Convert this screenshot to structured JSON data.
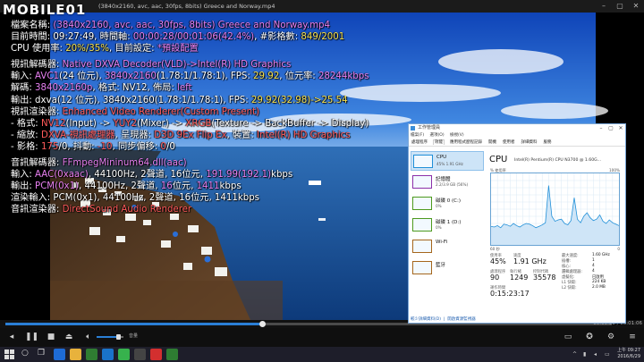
{
  "window": {
    "title": "(3840x2160, avc, aac, 30fps, 8bits) Greece and Norway.mp4",
    "logo": "MOBILE01"
  },
  "osd": {
    "lines": [
      [
        {
          "t": "檔案名稱: ",
          "c": ""
        },
        {
          "t": "(3840x2160, avc, aac, 30fps, 8bits) Greece and Norway.mp4",
          "c": "mg"
        }
      ],
      [
        {
          "t": "目前時間: 09:27:49, 時間軸: ",
          "c": ""
        },
        {
          "t": "00:00:28/00:01:06(42.4%)",
          "c": "mg"
        },
        {
          "t": ", #影格數: ",
          "c": ""
        },
        {
          "t": "849/2001",
          "c": "yl"
        }
      ],
      [
        {
          "t": "CPU 使用率: ",
          "c": ""
        },
        {
          "t": "20%/35%",
          "c": "yl"
        },
        {
          "t": ", 目前設定: ",
          "c": ""
        },
        {
          "t": "*預設配置",
          "c": "mg"
        }
      ],
      "gap",
      [
        {
          "t": "視訊解碼器: ",
          "c": ""
        },
        {
          "t": "Native DXVA Decoder(VLD)->Intel(R) HD Graphics",
          "c": "mg"
        }
      ],
      [
        {
          "t": "輸入: ",
          "c": ""
        },
        {
          "t": "AVC1",
          "c": "mg"
        },
        {
          "t": "(24 位元), ",
          "c": ""
        },
        {
          "t": "3840x2160",
          "c": "mg"
        },
        {
          "t": "(1.78:1/1.78:1), FPS: ",
          "c": ""
        },
        {
          "t": "29.92",
          "c": "yl"
        },
        {
          "t": ", 位元率: ",
          "c": ""
        },
        {
          "t": "28244kbps",
          "c": "mg"
        }
      ],
      [
        {
          "t": "解碼: ",
          "c": ""
        },
        {
          "t": "3840x2160p",
          "c": "mg"
        },
        {
          "t": ", 格式: NV12, 佈局: ",
          "c": ""
        },
        {
          "t": "left",
          "c": "mg"
        }
      ],
      [
        {
          "t": "輸出: dxva(12 位元), 3840x2160(1.78:1/1.78:1), FPS: ",
          "c": ""
        },
        {
          "t": "29.92(32.98)->25.54",
          "c": "yl"
        }
      ],
      [
        {
          "t": "視訊渲染器: ",
          "c": ""
        },
        {
          "t": "Enhanced Video Renderer(Custom Present)",
          "c": "rd"
        }
      ],
      [
        {
          "t": " - 格式: ",
          "c": ""
        },
        {
          "t": "NV12",
          "c": "rd"
        },
        {
          "t": "(Input) -> ",
          "c": ""
        },
        {
          "t": "YUY2",
          "c": "rd"
        },
        {
          "t": "(Mixer) -> ",
          "c": ""
        },
        {
          "t": "XRGB",
          "c": "rd"
        },
        {
          "t": "(Texture -> BackBuffer -> Display)",
          "c": ""
        }
      ],
      [
        {
          "t": " - 縮放: ",
          "c": ""
        },
        {
          "t": "DXVA-視訊處理器",
          "c": "rd"
        },
        {
          "t": ", 呈現器: ",
          "c": ""
        },
        {
          "t": "D3D 9Ex Flip Ex",
          "c": "rd"
        },
        {
          "t": ", 裝置: ",
          "c": ""
        },
        {
          "t": "Intel(R) HD Graphics",
          "c": "rd"
        }
      ],
      [
        {
          "t": " - 影格: ",
          "c": ""
        },
        {
          "t": "175",
          "c": "rd"
        },
        {
          "t": "/0, 抖動: ",
          "c": ""
        },
        {
          "t": "-10",
          "c": "rd"
        },
        {
          "t": ", 同步偏移: ",
          "c": ""
        },
        {
          "t": "0",
          "c": "rd"
        },
        {
          "t": "/0",
          "c": ""
        }
      ],
      "gap",
      [
        {
          "t": "音訊解碼器: ",
          "c": ""
        },
        {
          "t": "FFmpegMininum64.dll(aac)",
          "c": "mg"
        }
      ],
      [
        {
          "t": "輸入: ",
          "c": ""
        },
        {
          "t": "AAC(0xaac)",
          "c": "mg"
        },
        {
          "t": ", 44100Hz, 2聲道, 16位元, ",
          "c": ""
        },
        {
          "t": "191.99(192.1)",
          "c": "mg"
        },
        {
          "t": "kbps",
          "c": ""
        }
      ],
      [
        {
          "t": "輸出: ",
          "c": ""
        },
        {
          "t": "PCM(0x1)",
          "c": "mg"
        },
        {
          "t": ", 44100Hz, 2聲道, ",
          "c": ""
        },
        {
          "t": "16",
          "c": "mg"
        },
        {
          "t": "位元, ",
          "c": ""
        },
        {
          "t": "1411",
          "c": "mg"
        },
        {
          "t": "kbps",
          "c": ""
        }
      ],
      [
        {
          "t": "渲染輸入: PCM(0x1), 44100Hz, 2聲道, 16位元, 1411kbps",
          "c": ""
        }
      ],
      [
        {
          "t": "音訊渲染器: ",
          "c": ""
        },
        {
          "t": "DirectSound Audio Renderer",
          "c": "rd"
        }
      ]
    ]
  },
  "task_manager": {
    "title": "工作管理員",
    "menu": [
      "檔案(F)",
      "選項(O)",
      "檢視(V)"
    ],
    "tabs": [
      "處理程序",
      "效能",
      "應用程式歷程記錄",
      "開機",
      "使用者",
      "詳細資料",
      "服務"
    ],
    "active_tab": 1,
    "side": [
      {
        "name": "CPU",
        "sub": "45% 1.91 GHz",
        "color": "#1f8fd8"
      },
      {
        "name": "記憶體",
        "sub": "2.2/3.9 GB (56%)",
        "color": "#8b2fa8"
      },
      {
        "name": "磁碟 0 (C:)",
        "sub": "0%",
        "color": "#4d9a1e"
      },
      {
        "name": "磁碟 1 (D:)",
        "sub": "0%",
        "color": "#4d9a1e"
      },
      {
        "name": "Wi-Fi",
        "sub": "",
        "color": "#a5661d"
      },
      {
        "name": "藍牙",
        "sub": "",
        "color": "#a5661d"
      }
    ],
    "cpu_title": "CPU",
    "processor": "Intel(R) Pentium(R) CPU N3700 @ 1.60G...",
    "util_label": "% 使用率",
    "util_max": "100%",
    "graph_time": "60 秒",
    "graph_min": "0",
    "graph_values": [
      26,
      25,
      27,
      24,
      29,
      28,
      26,
      30,
      27,
      25,
      28,
      30,
      29,
      27,
      24,
      26,
      28,
      31,
      83,
      40,
      33,
      35,
      36,
      30,
      28,
      34,
      66,
      36,
      31,
      40,
      45,
      38,
      34,
      36,
      42,
      33,
      30,
      35,
      31,
      29,
      27
    ],
    "stats": {
      "util_label": "使用率",
      "util_val": "45%",
      "speed_label": "速度",
      "speed_val": "1.91 GHz",
      "proc_label": "處理程序",
      "proc_val": "90",
      "thr_label": "執行緒",
      "thr_val": "1249",
      "hnd_label": "控制代碼",
      "hnd_val": "35578",
      "up_label": "運作時間",
      "up_val": "0:15:23:17"
    },
    "specs": [
      {
        "k": "最大速度:",
        "v": "1.60 GHz"
      },
      {
        "k": "插槽:",
        "v": "1"
      },
      {
        "k": "核心:",
        "v": "4"
      },
      {
        "k": "邏輯處理器:",
        "v": "4"
      },
      {
        "k": "虛擬化:",
        "v": "已啟用"
      },
      {
        "k": "L1 快取:",
        "v": "224 KB"
      },
      {
        "k": "L2 快取:",
        "v": "2.0 MB"
      }
    ],
    "footer_less": "較少詳細資料(D)",
    "footer_monitor": "開啟資源監視器"
  },
  "player": {
    "progress": 0.424,
    "volume": 0.8,
    "vol_label": "音量",
    "time_display": "00:00:28 / 00:01:06"
  },
  "taskbar": {
    "clock_time": "上午 09:27",
    "clock_date": "2016/6/29",
    "colors": {
      "accent": "#2a7fd6",
      "taskbar": "#1e1e2a"
    }
  }
}
